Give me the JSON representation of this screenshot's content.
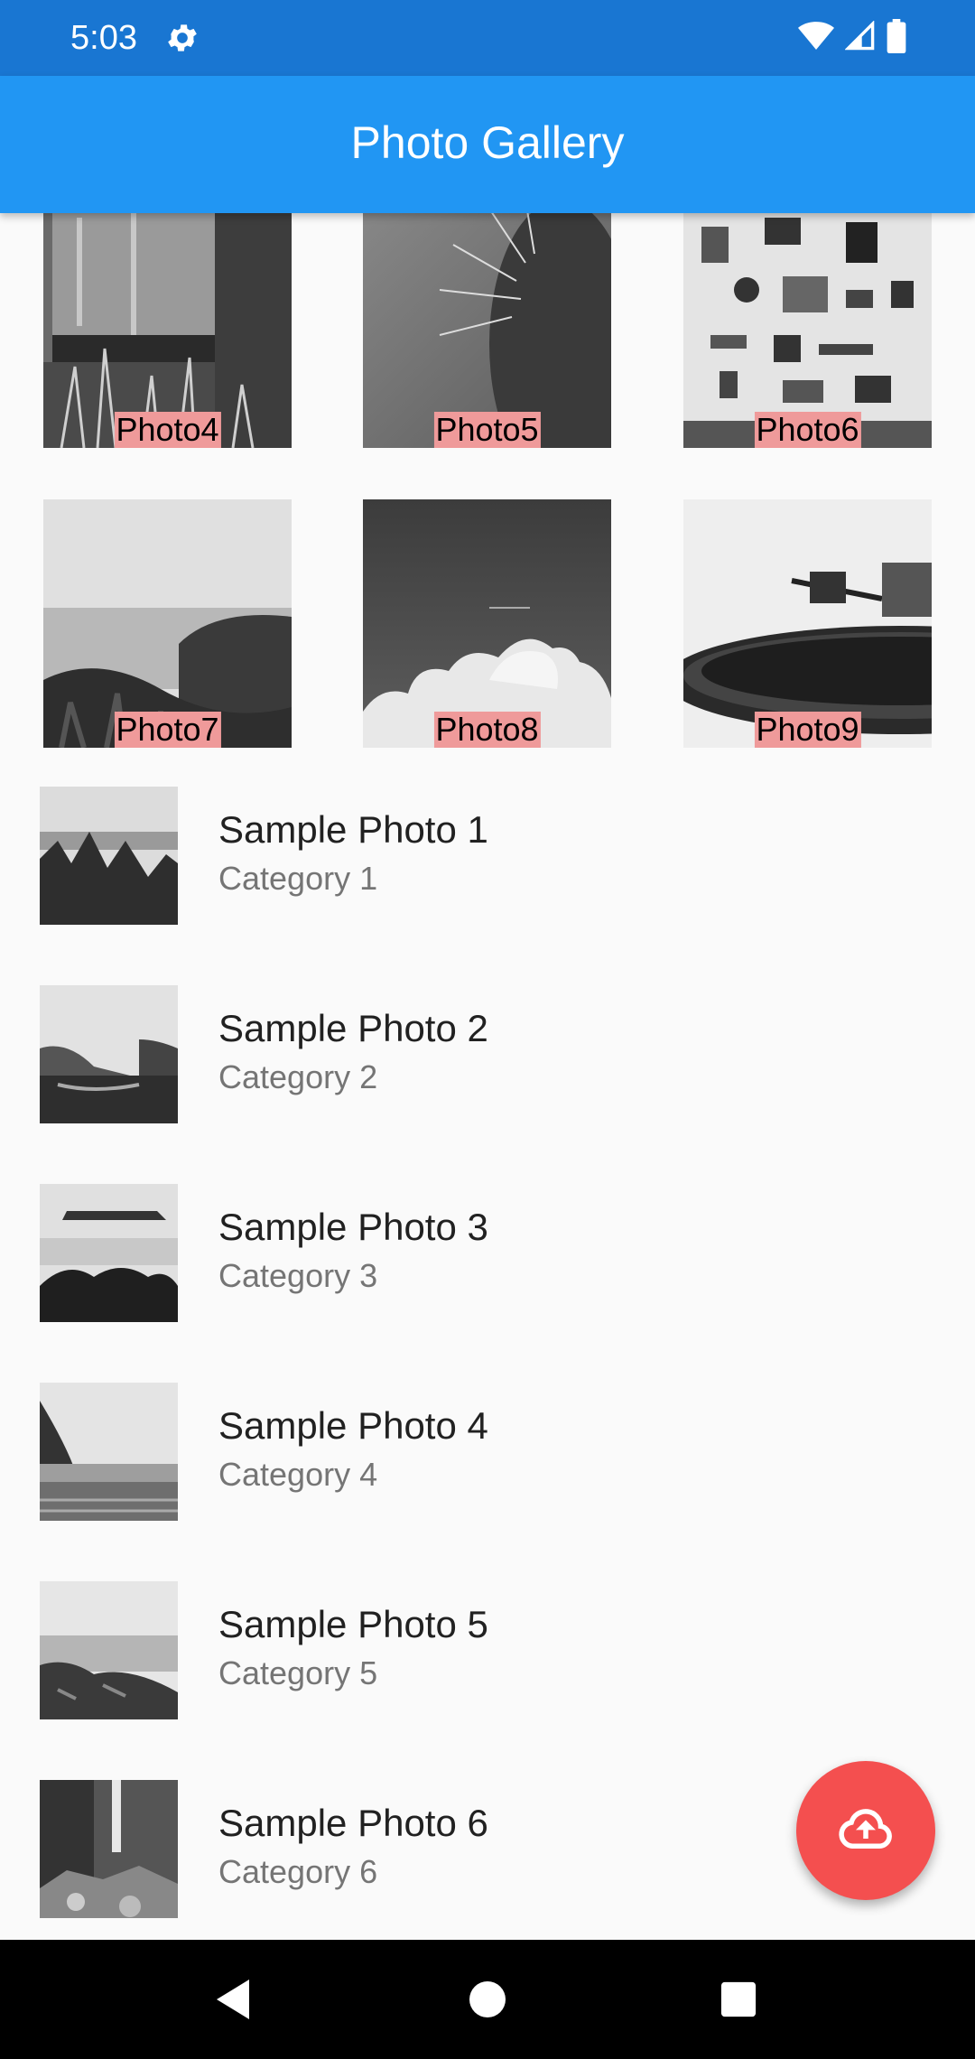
{
  "status_bar": {
    "time": "5:03",
    "icons": [
      "gear-icon",
      "wifi-icon",
      "cell-signal-icon",
      "battery-icon"
    ]
  },
  "app_bar": {
    "title": "Photo Gallery"
  },
  "grid": {
    "tiles": [
      {
        "label": "Photo4"
      },
      {
        "label": "Photo5"
      },
      {
        "label": "Photo6"
      },
      {
        "label": "Photo7"
      },
      {
        "label": "Photo8"
      },
      {
        "label": "Photo9"
      }
    ]
  },
  "list": {
    "items": [
      {
        "title": "Sample Photo 1",
        "category": "Category 1"
      },
      {
        "title": "Sample Photo 2",
        "category": "Category 2"
      },
      {
        "title": "Sample Photo 3",
        "category": "Category 3"
      },
      {
        "title": "Sample Photo 4",
        "category": "Category 4"
      },
      {
        "title": "Sample Photo 5",
        "category": "Category 5"
      },
      {
        "title": "Sample Photo 6",
        "category": "Category 6"
      }
    ]
  },
  "fab": {
    "icon": "cloud-upload-icon",
    "color": "#f44f4f"
  },
  "nav_bar": {
    "icons": [
      "back-icon",
      "home-icon",
      "recents-icon"
    ]
  },
  "colors": {
    "app_bar": "#2196f3",
    "status_bar": "#1976d2",
    "label_bg": "#ef9a9a",
    "background": "#fafafa"
  }
}
